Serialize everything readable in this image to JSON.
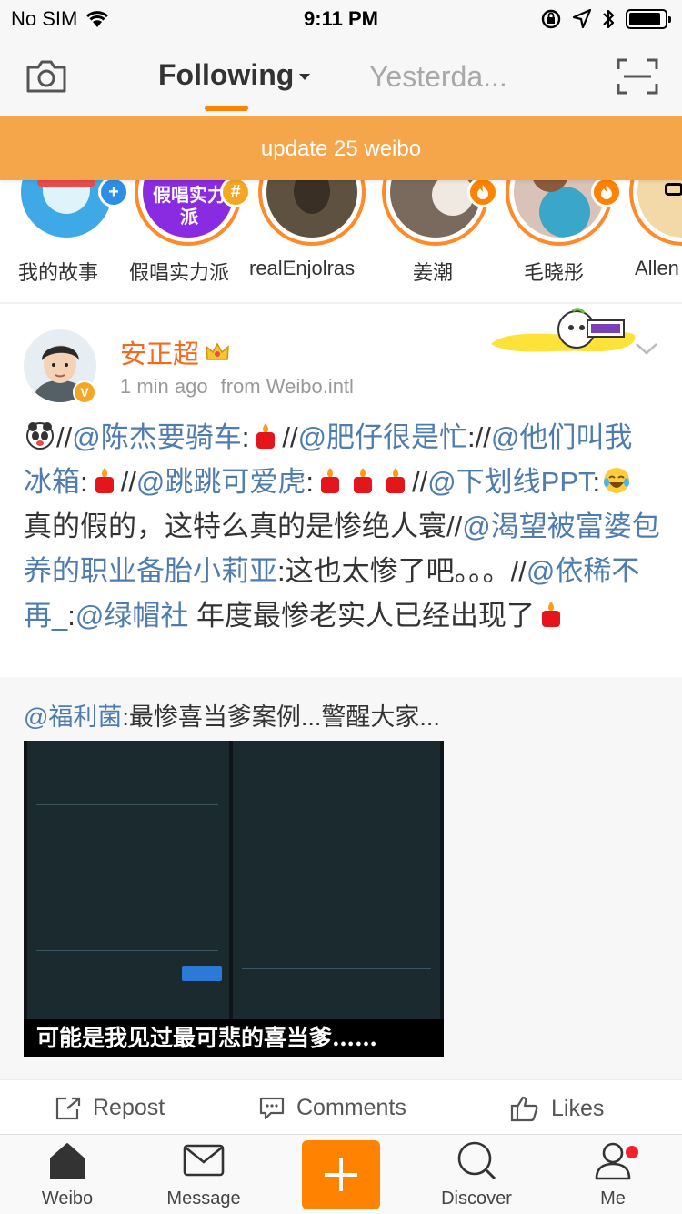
{
  "status_bar": {
    "carrier": "No SIM",
    "time": "9:11 PM"
  },
  "nav": {
    "following_label": "Following",
    "yesterday_label": "Yesterda..."
  },
  "banner": {
    "text": "update 25 weibo"
  },
  "stories": [
    {
      "label": "我的故事",
      "badge": "+"
    },
    {
      "label": "假唱实力派",
      "badge": "#",
      "avatar_text": "假唱实力派"
    },
    {
      "label": "realEnjolras"
    },
    {
      "label": "姜潮",
      "badge": "fire"
    },
    {
      "label": "毛晓彤",
      "badge": "fire"
    },
    {
      "label": "Allen"
    }
  ],
  "post": {
    "author": "安正超",
    "time": "1 min ago",
    "source": "from Weibo.intl",
    "body": {
      "p1": "//",
      "m1": "@陈杰要骑车",
      "p2": ":",
      "p3": "//",
      "m2": "@肥仔很是忙",
      "p4": "://",
      "m3": "@他们叫我冰箱",
      "p5": ":",
      "p6": "//",
      "m4": "@跳跳可爱虎",
      "p7": ":",
      "p8": "//",
      "m5": "@下划线PPT",
      "p9": ":",
      "p10": "真的假的，这特么真的是惨绝人寰//",
      "m6": "@渴望被富婆包养的职业备胎小莉亚",
      "p11": ":这也太惨了吧。。。//",
      "m7": "@依稀不再_",
      "p12": ":",
      "m8": "@绿帽社",
      "p13": "  年度最惨老实人已经出现了"
    }
  },
  "repost": {
    "mention": "@福利菌",
    "text": ":最惨喜当爹案例...警醒大家...",
    "image_caption": "可能是我见过最可悲的喜当爹……"
  },
  "actions": {
    "repost": "Repost",
    "comments": "Comments",
    "likes": "Likes"
  },
  "tabbar": {
    "weibo": "Weibo",
    "message": "Message",
    "discover": "Discover",
    "me": "Me"
  },
  "colors": {
    "accent": "#ff8200",
    "banner": "#f6a64a",
    "mention": "#4f7cae",
    "author": "#f86819"
  }
}
